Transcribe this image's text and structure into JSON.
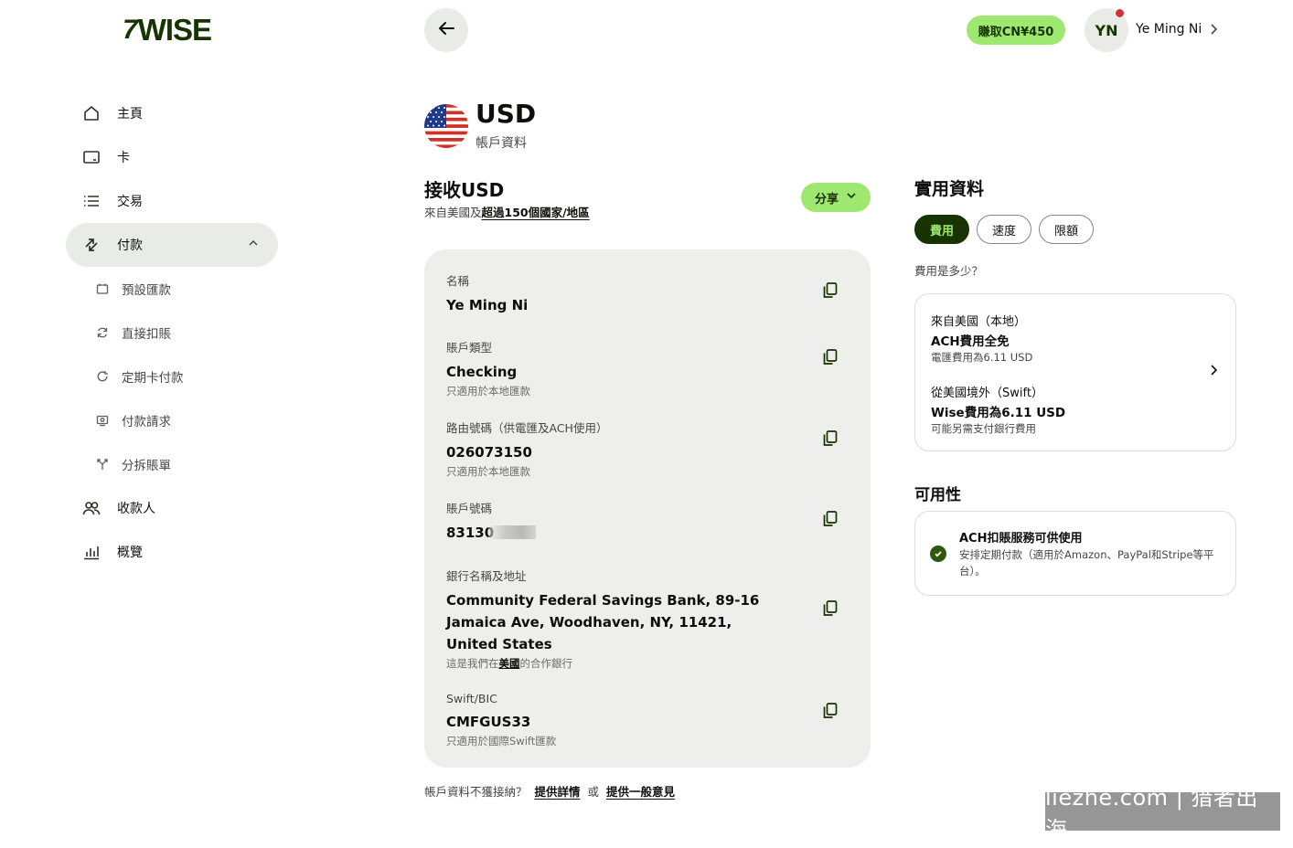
{
  "brand": {
    "mark": "7",
    "name": "WISE"
  },
  "sidebar": {
    "items": [
      {
        "label": "主頁",
        "icon": "home-icon"
      },
      {
        "label": "卡",
        "icon": "card-icon"
      },
      {
        "label": "交易",
        "icon": "list-icon"
      },
      {
        "label": "付款",
        "icon": "payments-icon",
        "active": true
      },
      {
        "label": "收款人",
        "icon": "recipients-icon"
      },
      {
        "label": "概覽",
        "icon": "insights-icon"
      }
    ],
    "sub_items": [
      {
        "label": "預設匯款",
        "icon": "calendar-icon"
      },
      {
        "label": "直接扣賬",
        "icon": "refresh-icon"
      },
      {
        "label": "定期卡付款",
        "icon": "recurring-icon"
      },
      {
        "label": "付款請求",
        "icon": "request-icon"
      },
      {
        "label": "分拆賬單",
        "icon": "split-icon"
      }
    ]
  },
  "topbar": {
    "earn_label": "賺取CN¥450",
    "avatar_initials": "YN",
    "user_name": "Ye Ming Ni"
  },
  "currency": {
    "code": "USD",
    "subtitle": "帳戶資料",
    "flag": "us-flag-icon"
  },
  "receive": {
    "title": "接收USD",
    "subtitle_prefix": "來自美國及",
    "subtitle_link": "超過150個國家/地區",
    "share_label": "分享"
  },
  "details": {
    "name": {
      "label": "名稱",
      "value": "Ye Ming Ni"
    },
    "account_type": {
      "label": "賬戶類型",
      "value": "Checking",
      "note": "只適用於本地匯款"
    },
    "routing": {
      "label": "路由號碼（供電匯及ACH使用）",
      "value": "026073150",
      "note": "只適用於本地匯款"
    },
    "account_number": {
      "label": "賬戶號碼",
      "value": "83130"
    },
    "bank": {
      "label": "銀行名稱及地址",
      "value": "Community Federal Savings Bank, 89-16 Jamaica Ave, Woodhaven, NY, 11421, United States",
      "note_prefix": "這是我們在",
      "note_link": "美國",
      "note_suffix": "的合作銀行"
    },
    "swift": {
      "label": "Swift/BIC",
      "value": "CMFGUS33",
      "note": "只適用於國際Swift匯款"
    }
  },
  "feedback": {
    "prefix": "帳戶資料不獲接納？",
    "link1": "提供詳情",
    "or": "或",
    "link2": "提供一般意見"
  },
  "info": {
    "title": "實用資料",
    "tabs": [
      "費用",
      "速度",
      "限額"
    ],
    "fee_question": "費用是多少？",
    "fees": {
      "local_title": "來自美國（本地）",
      "local_value": "ACH費用全免",
      "local_note": "電匯費用為6.11 USD",
      "intl_title": "從美國境外（Swift）",
      "intl_value": "Wise費用為6.11 USD",
      "intl_note": "可能另需支付銀行費用"
    },
    "availability_title": "可用性",
    "availability": {
      "heading": "ACH扣賬服務可供使用",
      "desc": "安排定期付款（適用於Amazon、PayPal和Stripe等平台）。"
    }
  },
  "watermark": "liezhe.com | 猎者出海",
  "colors": {
    "brand_green": "#9fe870",
    "forest": "#163300",
    "card_bg": "#eeefec",
    "notification": "#d03238"
  }
}
